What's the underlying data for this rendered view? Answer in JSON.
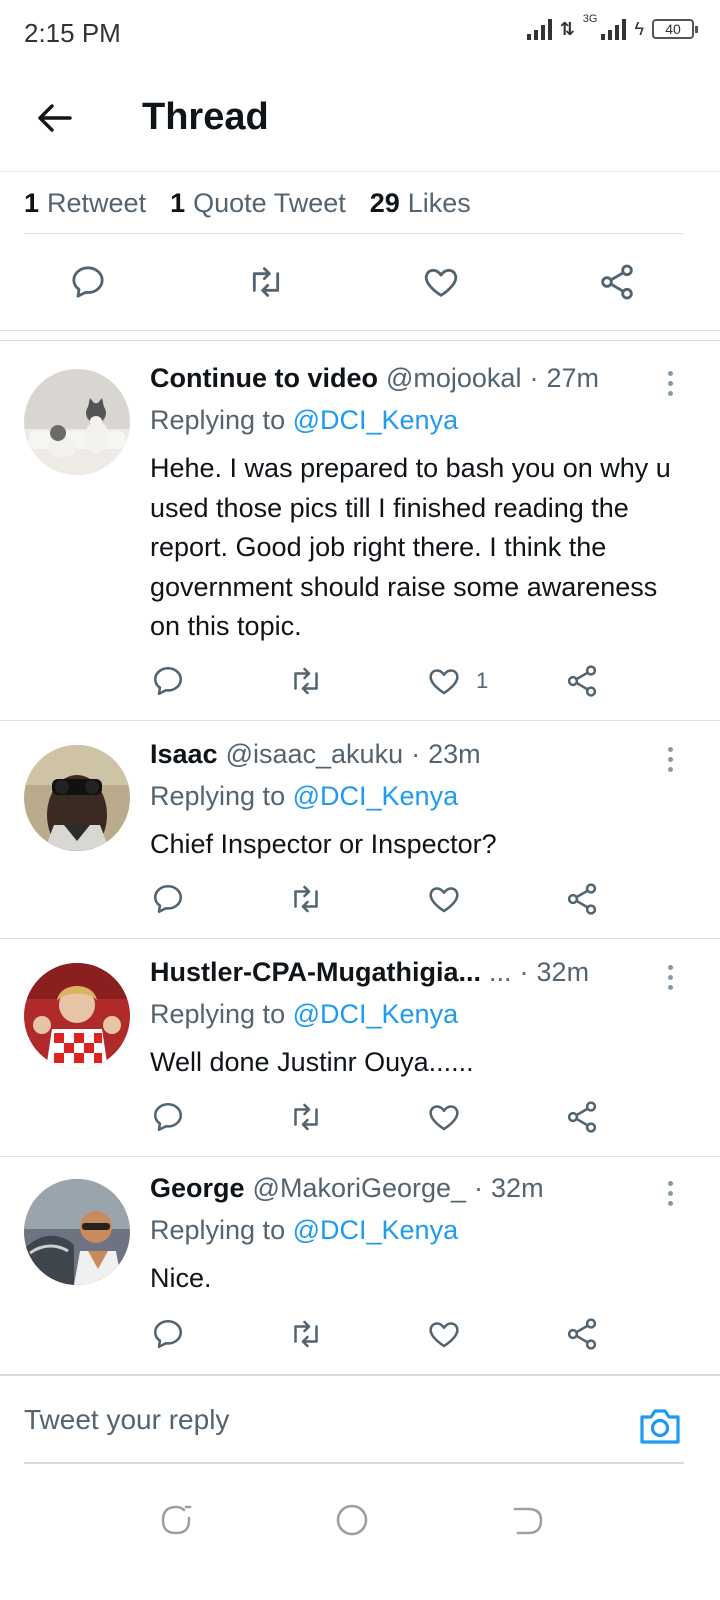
{
  "status_bar": {
    "time": "2:15 PM",
    "network": "3G",
    "battery": "40"
  },
  "header": {
    "title": "Thread"
  },
  "stats": [
    {
      "count": "1",
      "label": "Retweet"
    },
    {
      "count": "1",
      "label": "Quote Tweet"
    },
    {
      "count": "29",
      "label": "Likes"
    }
  ],
  "replies": [
    {
      "name": "Continue to video",
      "handle": "@mojookal",
      "time": "27m",
      "replying_prefix": "Replying to",
      "replying_to": "@DCI_Kenya",
      "text": "Hehe. I was prepared to bash you on why u used those pics till I finished reading the report. Good job right there. I think the government should raise some awareness on this topic.",
      "likes": "1"
    },
    {
      "name": "Isaac",
      "handle": "@isaac_akuku",
      "time": "23m",
      "replying_prefix": "Replying to",
      "replying_to": "@DCI_Kenya",
      "text": "Chief Inspector or Inspector?",
      "likes": ""
    },
    {
      "name": "Hustler-CPA-Mugathigia...",
      "handle": "...",
      "time": "32m",
      "replying_prefix": "Replying to",
      "replying_to": "@DCI_Kenya",
      "text": "Well done Justinr Ouya......",
      "likes": ""
    },
    {
      "name": "George",
      "handle": "@MakoriGeorge_",
      "time": "32m",
      "replying_prefix": "Replying to",
      "replying_to": "@DCI_Kenya",
      "text": "Nice.",
      "likes": ""
    }
  ],
  "reply_bar": {
    "placeholder": "Tweet your reply"
  },
  "colors": {
    "accent": "#1d9bf0",
    "secondary_text": "#536471",
    "primary_text": "#0f1419"
  }
}
